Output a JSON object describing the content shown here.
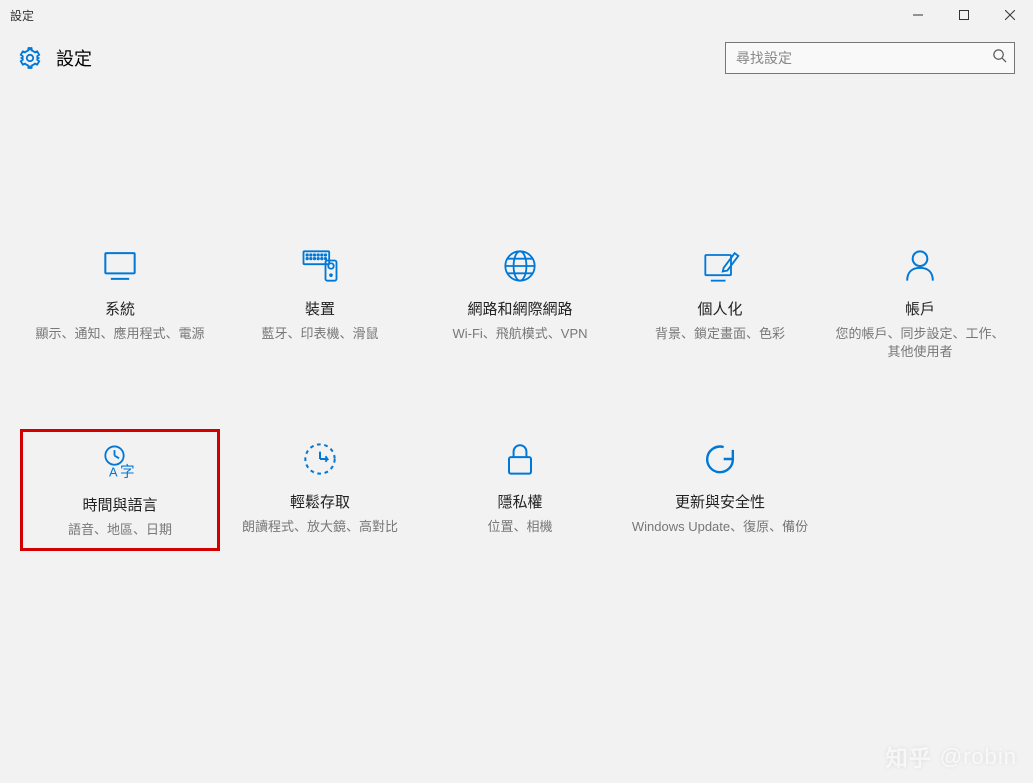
{
  "window": {
    "title": "設定",
    "minimize": "—",
    "maximize": "☐",
    "close": "✕"
  },
  "header": {
    "title": "設定"
  },
  "search": {
    "placeholder": "尋找設定"
  },
  "tiles": [
    {
      "title": "系統",
      "desc": "顯示、通知、應用程式、電源"
    },
    {
      "title": "裝置",
      "desc": "藍牙、印表機、滑鼠"
    },
    {
      "title": "網路和網際網路",
      "desc": "Wi-Fi、飛航模式、VPN"
    },
    {
      "title": "個人化",
      "desc": "背景、鎖定畫面、色彩"
    },
    {
      "title": "帳戶",
      "desc": "您的帳戶、同步設定、工作、其他使用者"
    },
    {
      "title": "時間與語言",
      "desc": "語音、地區、日期"
    },
    {
      "title": "輕鬆存取",
      "desc": "朗讀程式、放大鏡、高對比"
    },
    {
      "title": "隱私權",
      "desc": "位置、相機"
    },
    {
      "title": "更新與安全性",
      "desc": "Windows Update、復原、備份"
    }
  ],
  "watermark": {
    "logo": "知乎",
    "user": "@robin"
  }
}
